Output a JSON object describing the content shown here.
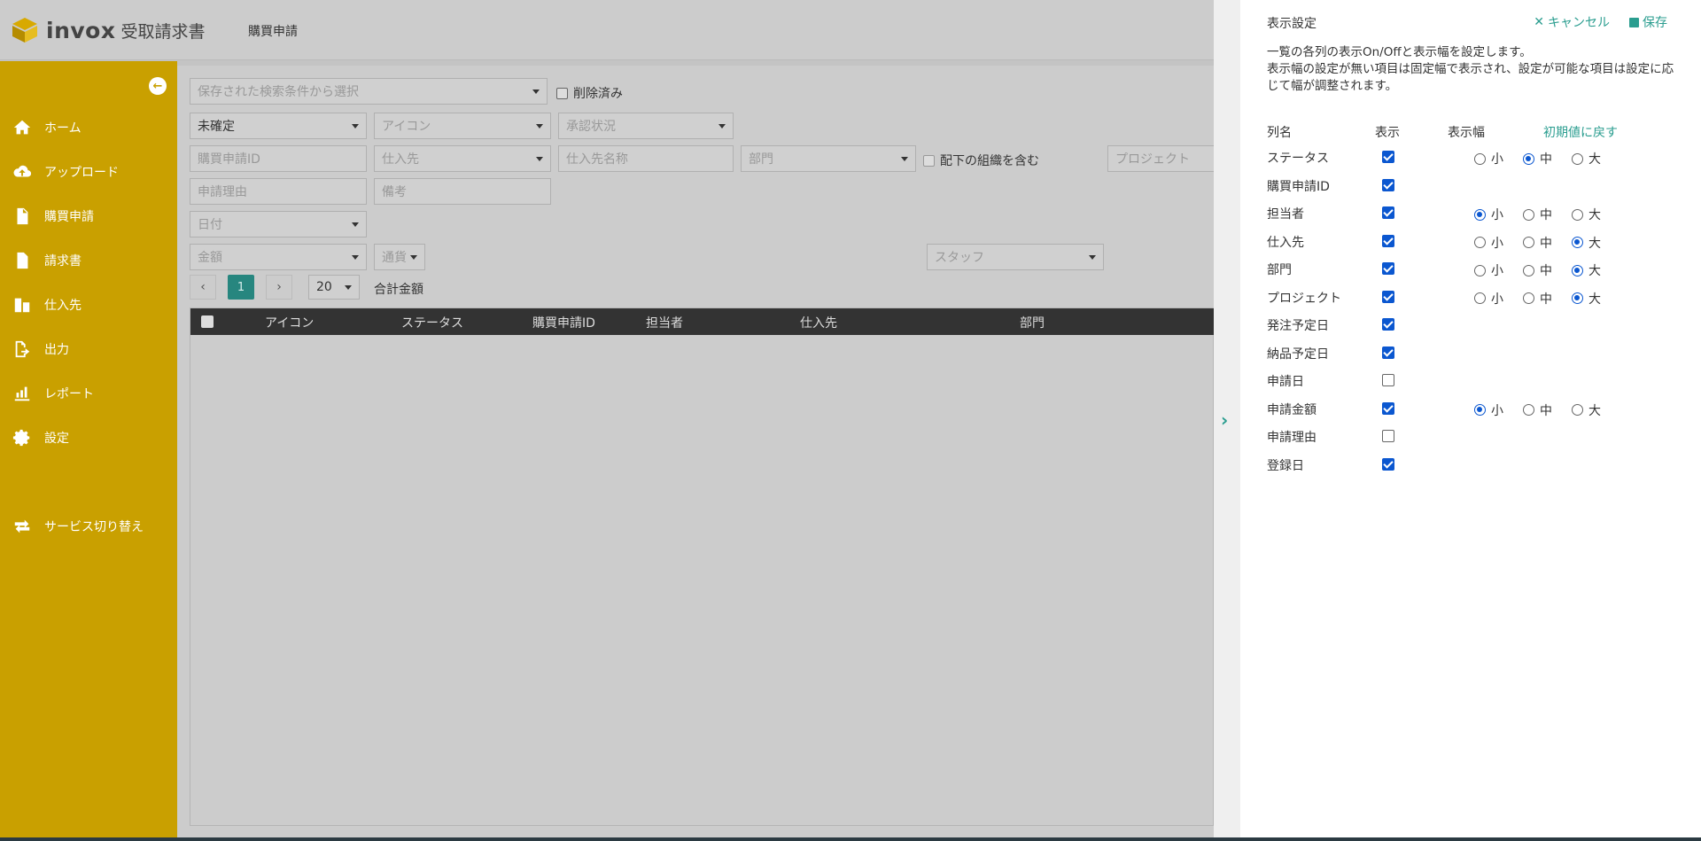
{
  "app": {
    "logo_text": "invox",
    "logo_sub": "受取請求書",
    "page_title": "購買申請"
  },
  "sidebar": {
    "items": [
      {
        "label": "ホーム",
        "icon": "home-icon"
      },
      {
        "label": "アップロード",
        "icon": "cloud-upload-icon"
      },
      {
        "label": "購買申請",
        "icon": "document-icon"
      },
      {
        "label": "請求書",
        "icon": "invoice-icon"
      },
      {
        "label": "仕入先",
        "icon": "building-icon"
      },
      {
        "label": "出力",
        "icon": "export-icon"
      },
      {
        "label": "レポート",
        "icon": "chart-icon"
      },
      {
        "label": "設定",
        "icon": "gear-icon"
      },
      {
        "label": "サービス切り替え",
        "icon": "switch-icon"
      }
    ]
  },
  "filters": {
    "saved_search": "保存された検索条件から選択",
    "deleted_label": "削除済み",
    "status": "未確定",
    "icon": "アイコン",
    "approval": "承認状況",
    "request_id": "購買申請ID",
    "supplier": "仕入先",
    "supplier_name": "仕入先名称",
    "department": "部門",
    "include_sub_label": "配下の組織を含む",
    "project": "プロジェクト",
    "reason": "申請理由",
    "memo": "備考",
    "date": "日付",
    "amount": "金額",
    "currency": "通貨",
    "staff": "スタッフ"
  },
  "pager": {
    "current": "1",
    "per_page": "20",
    "total_label": "合計金額"
  },
  "table": {
    "columns": [
      "アイコン",
      "ステータス",
      "購買申請ID",
      "担当者",
      "仕入先",
      "部門"
    ]
  },
  "panel": {
    "title": "表示設定",
    "cancel": "キャンセル",
    "save": "保存",
    "desc1": "一覧の各列の表示On/Offと表示幅を設定します。",
    "desc2": "表示幅の設定が無い項目は固定幅で表示され、設定が可能な項目は設定に応じて幅が調整されます。",
    "head_name": "列名",
    "head_show": "表示",
    "head_width": "表示幅",
    "reset": "初期値に戻す",
    "size_labels": [
      "小",
      "中",
      "大"
    ],
    "rows": [
      {
        "name": "ステータス",
        "show": true,
        "width": "中"
      },
      {
        "name": "購買申請ID",
        "show": true,
        "width": null
      },
      {
        "name": "担当者",
        "show": true,
        "width": "小"
      },
      {
        "name": "仕入先",
        "show": true,
        "width": "大"
      },
      {
        "name": "部門",
        "show": true,
        "width": "大"
      },
      {
        "name": "プロジェクト",
        "show": true,
        "width": "大"
      },
      {
        "name": "発注予定日",
        "show": true,
        "width": null
      },
      {
        "name": "納品予定日",
        "show": true,
        "width": null
      },
      {
        "name": "申請日",
        "show": false,
        "width": null
      },
      {
        "name": "申請金額",
        "show": true,
        "width": "小"
      },
      {
        "name": "申請理由",
        "show": false,
        "width": null
      },
      {
        "name": "登録日",
        "show": true,
        "width": null
      }
    ]
  },
  "colors": {
    "sidebar": "#c9a000",
    "accent": "#2a9d8f",
    "checkbox": "#0b57d0"
  }
}
